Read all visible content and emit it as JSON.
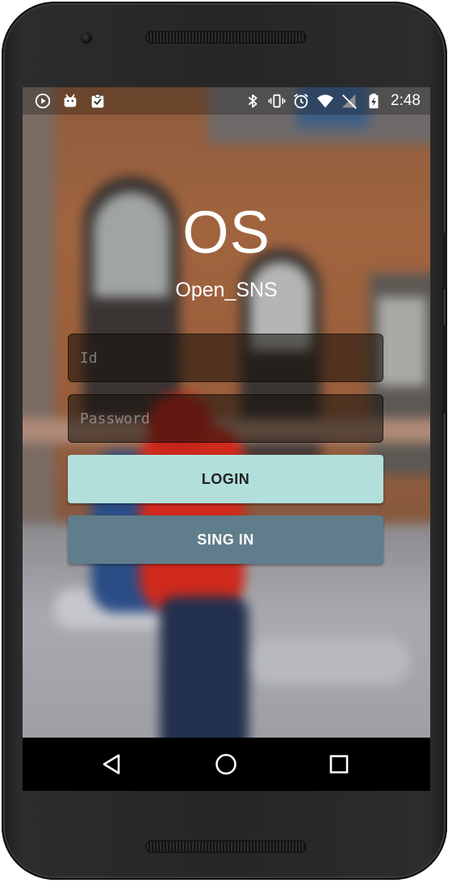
{
  "status_bar": {
    "left_icons": [
      "play-circle-icon",
      "android-debug-icon",
      "clipboard-check-icon"
    ],
    "right_icons": [
      "bluetooth-icon",
      "vibrate-icon",
      "alarm-icon",
      "wifi-icon",
      "no-signal-icon",
      "battery-charging-icon"
    ],
    "time": "2:48"
  },
  "app": {
    "logo": "OS",
    "name": "Open_SNS"
  },
  "form": {
    "id_placeholder": "Id",
    "id_value": "",
    "password_placeholder": "Password",
    "password_value": ""
  },
  "actions": {
    "login_label": "LOGIN",
    "signin_label": "SING IN"
  },
  "navigation": {
    "back_icon": "back-triangle-icon",
    "home_icon": "home-circle-icon",
    "recents_icon": "recents-square-icon"
  },
  "colors": {
    "login_button": "#b2dfdb",
    "signin_button": "#607d8b",
    "nav_bar": "#000000",
    "device_body": "#262626"
  }
}
